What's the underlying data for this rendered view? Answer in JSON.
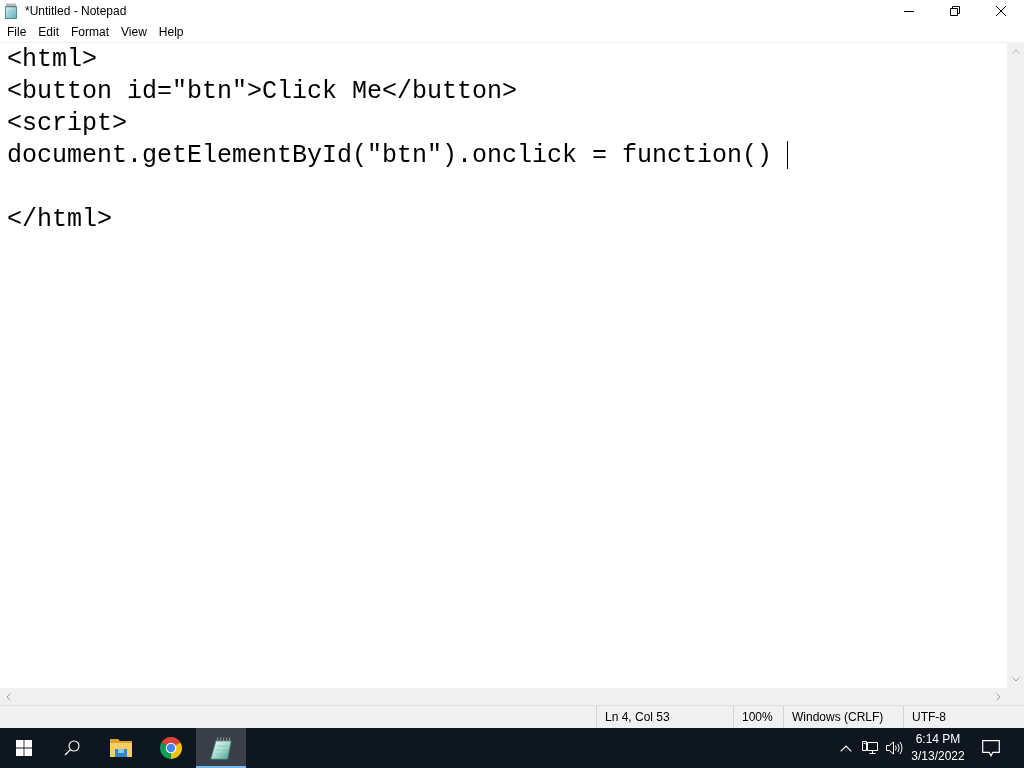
{
  "window": {
    "title": "*Untitled - Notepad"
  },
  "menu": [
    "File",
    "Edit",
    "Format",
    "View",
    "Help"
  ],
  "editor": {
    "lines": [
      {
        "kind": "code",
        "text": "<html>",
        "caret": false
      },
      {
        "kind": "code",
        "text": "<button id=\"btn\">Click Me</button>",
        "caret": false
      },
      {
        "kind": "code",
        "text": "<script>",
        "caret": false
      },
      {
        "kind": "code",
        "text": "document.getElementById(\"btn\").onclick = function()",
        "caret": true
      },
      {
        "kind": "blank",
        "caret": false
      },
      {
        "kind": "code",
        "text": "</html>",
        "caret": false
      }
    ]
  },
  "status_bar": {
    "position": "Ln 4, Col 53",
    "zoom": "100%",
    "line_ending": "Windows (CRLF)",
    "encoding": "UTF-8"
  },
  "taskbar": {
    "apps": [
      {
        "kind": "folder",
        "selected": false
      },
      {
        "kind": "browser",
        "selected": false
      },
      {
        "kind": "notepad",
        "selected": true
      }
    ],
    "clock": {
      "time": "6:14 PM",
      "date": "3/13/2022"
    }
  }
}
